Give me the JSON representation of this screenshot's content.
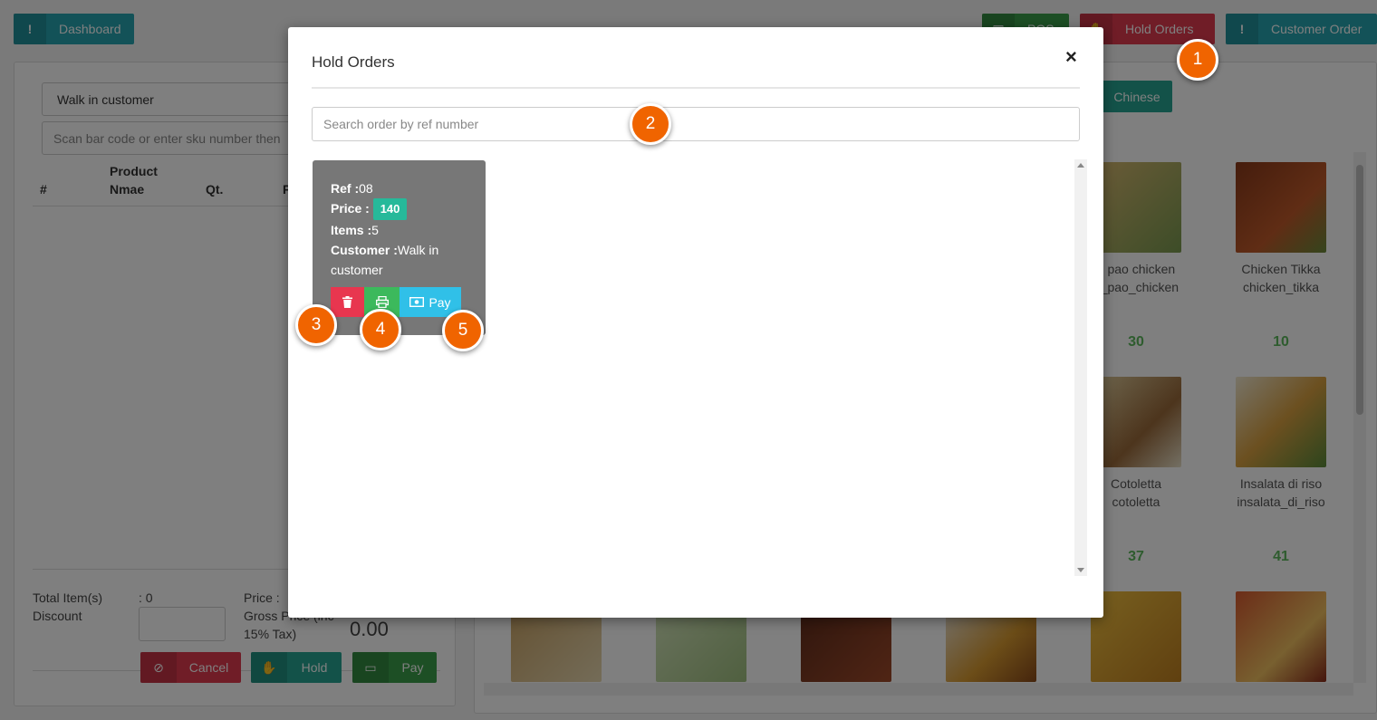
{
  "header": {
    "dashboard": "Dashboard",
    "pos": "POS",
    "hold_orders": "Hold Orders",
    "customer_order": "Customer Order"
  },
  "cart": {
    "customer_select": "Walk in customer",
    "scan_placeholder": "Scan bar code or enter sku number then",
    "columns": [
      "#",
      "Product Nmae",
      "Qt.",
      "P"
    ],
    "total_items_label": "Total Item(s)",
    "total_items_value": ": 0",
    "discount_label": "Discount",
    "price_label": "Price :",
    "gross_price_label": "Gross Price (inc 15% Tax)",
    "gross_price_value": "0.00",
    "cancel": "Cancel",
    "hold": "Hold",
    "pay": "Pay"
  },
  "categories": {
    "chinese": "Chinese"
  },
  "products": [
    {
      "name": "g pao chicken",
      "sku": "g_pao_chicken",
      "qty": "30"
    },
    {
      "name": "Chicken Tikka",
      "sku": "chicken_tikka",
      "qty": "10"
    },
    {
      "name": "Cotoletta",
      "sku": "cotoletta",
      "qty": "37"
    },
    {
      "name": "Insalata di riso",
      "sku": "insalata_di_riso",
      "qty": "41"
    }
  ],
  "modal": {
    "title": "Hold Orders",
    "close": "×",
    "search_placeholder": "Search order by ref number",
    "orders": [
      {
        "ref_label": "Ref :",
        "ref": "08",
        "price_label": "Price :",
        "price": "140",
        "items_label": "Items :",
        "items": "5",
        "customer_label": "Customer :",
        "customer": "Walk in customer",
        "pay_label": "Pay"
      }
    ]
  },
  "callouts": [
    "1",
    "2",
    "3",
    "4",
    "5"
  ],
  "colors": {
    "teal": "#26a5b0",
    "red": "#e03a4e",
    "green": "#3a9f4a",
    "callout": "#f06400",
    "badge": "#26b99a"
  },
  "icons": {
    "dashboard": "exclamation-icon",
    "pos": "grid-icon",
    "hold_orders": "hand-icon",
    "customer_order": "exclamation-icon",
    "delete": "trash-icon",
    "print": "print-icon",
    "pay": "money-icon"
  }
}
